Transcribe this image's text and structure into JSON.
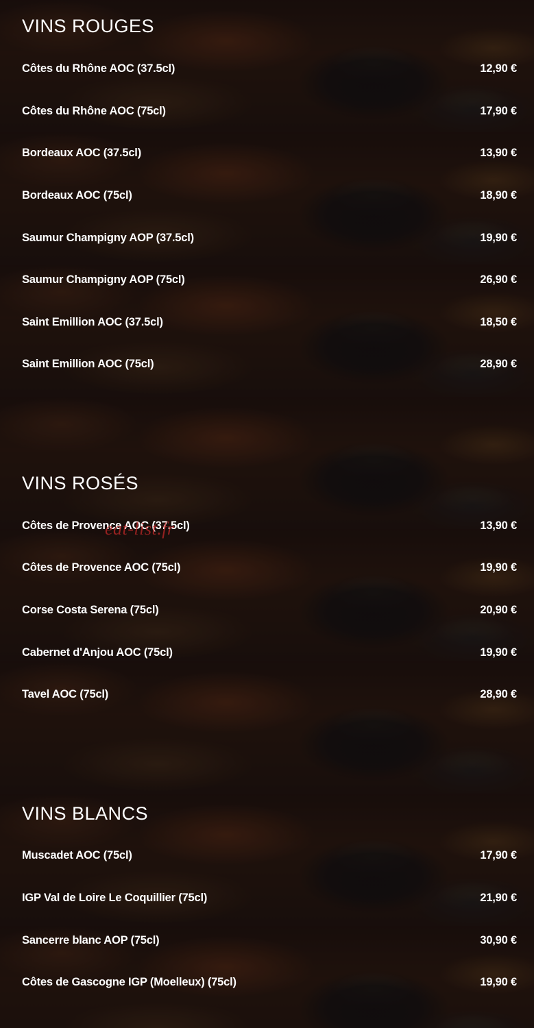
{
  "sections": [
    {
      "title": "VINS ROUGES",
      "items": [
        {
          "name": "Côtes du Rhône AOC (37.5cl)",
          "price": "12,90 €"
        },
        {
          "name": "Côtes du Rhône AOC (75cl)",
          "price": "17,90 €"
        },
        {
          "name": "Bordeaux AOC (37.5cl)",
          "price": "13,90 €"
        },
        {
          "name": "Bordeaux AOC (75cl)",
          "price": "18,90 €"
        },
        {
          "name": "Saumur Champigny AOP (37.5cl)",
          "price": "19,90 €"
        },
        {
          "name": "Saumur Champigny AOP (75cl)",
          "price": "26,90 €"
        },
        {
          "name": "Saint Emillion AOC (37.5cl)",
          "price": "18,50 €"
        },
        {
          "name": "Saint Emillion AOC (75cl)",
          "price": "28,90 €"
        }
      ]
    },
    {
      "title": "VINS ROSÉS",
      "items": [
        {
          "name": "Côtes de Provence AOC (37.5cl)",
          "price": "13,90 €"
        },
        {
          "name": "Côtes de Provence AOC (75cl)",
          "price": "19,90 €"
        },
        {
          "name": "Corse Costa Serena (75cl)",
          "price": "20,90 €"
        },
        {
          "name": "Cabernet d'Anjou AOC (75cl)",
          "price": "19,90 €"
        },
        {
          "name": "Tavel AOC (75cl)",
          "price": "28,90 €"
        }
      ]
    },
    {
      "title": "VINS BLANCS",
      "items": [
        {
          "name": "Muscadet AOC (75cl)",
          "price": "17,90 €"
        },
        {
          "name": "IGP Val de Loire Le Coquillier (75cl)",
          "price": "21,90 €"
        },
        {
          "name": "Sancerre blanc AOP (75cl)",
          "price": "30,90 €"
        },
        {
          "name": "Côtes de Gascogne IGP (Moelleux) (75cl)",
          "price": "19,90 €"
        }
      ]
    }
  ],
  "watermark": "eat-list.fr",
  "colors": {
    "text": "#ffffff",
    "watermark": "#be2828",
    "background": "#1a0f0d"
  }
}
